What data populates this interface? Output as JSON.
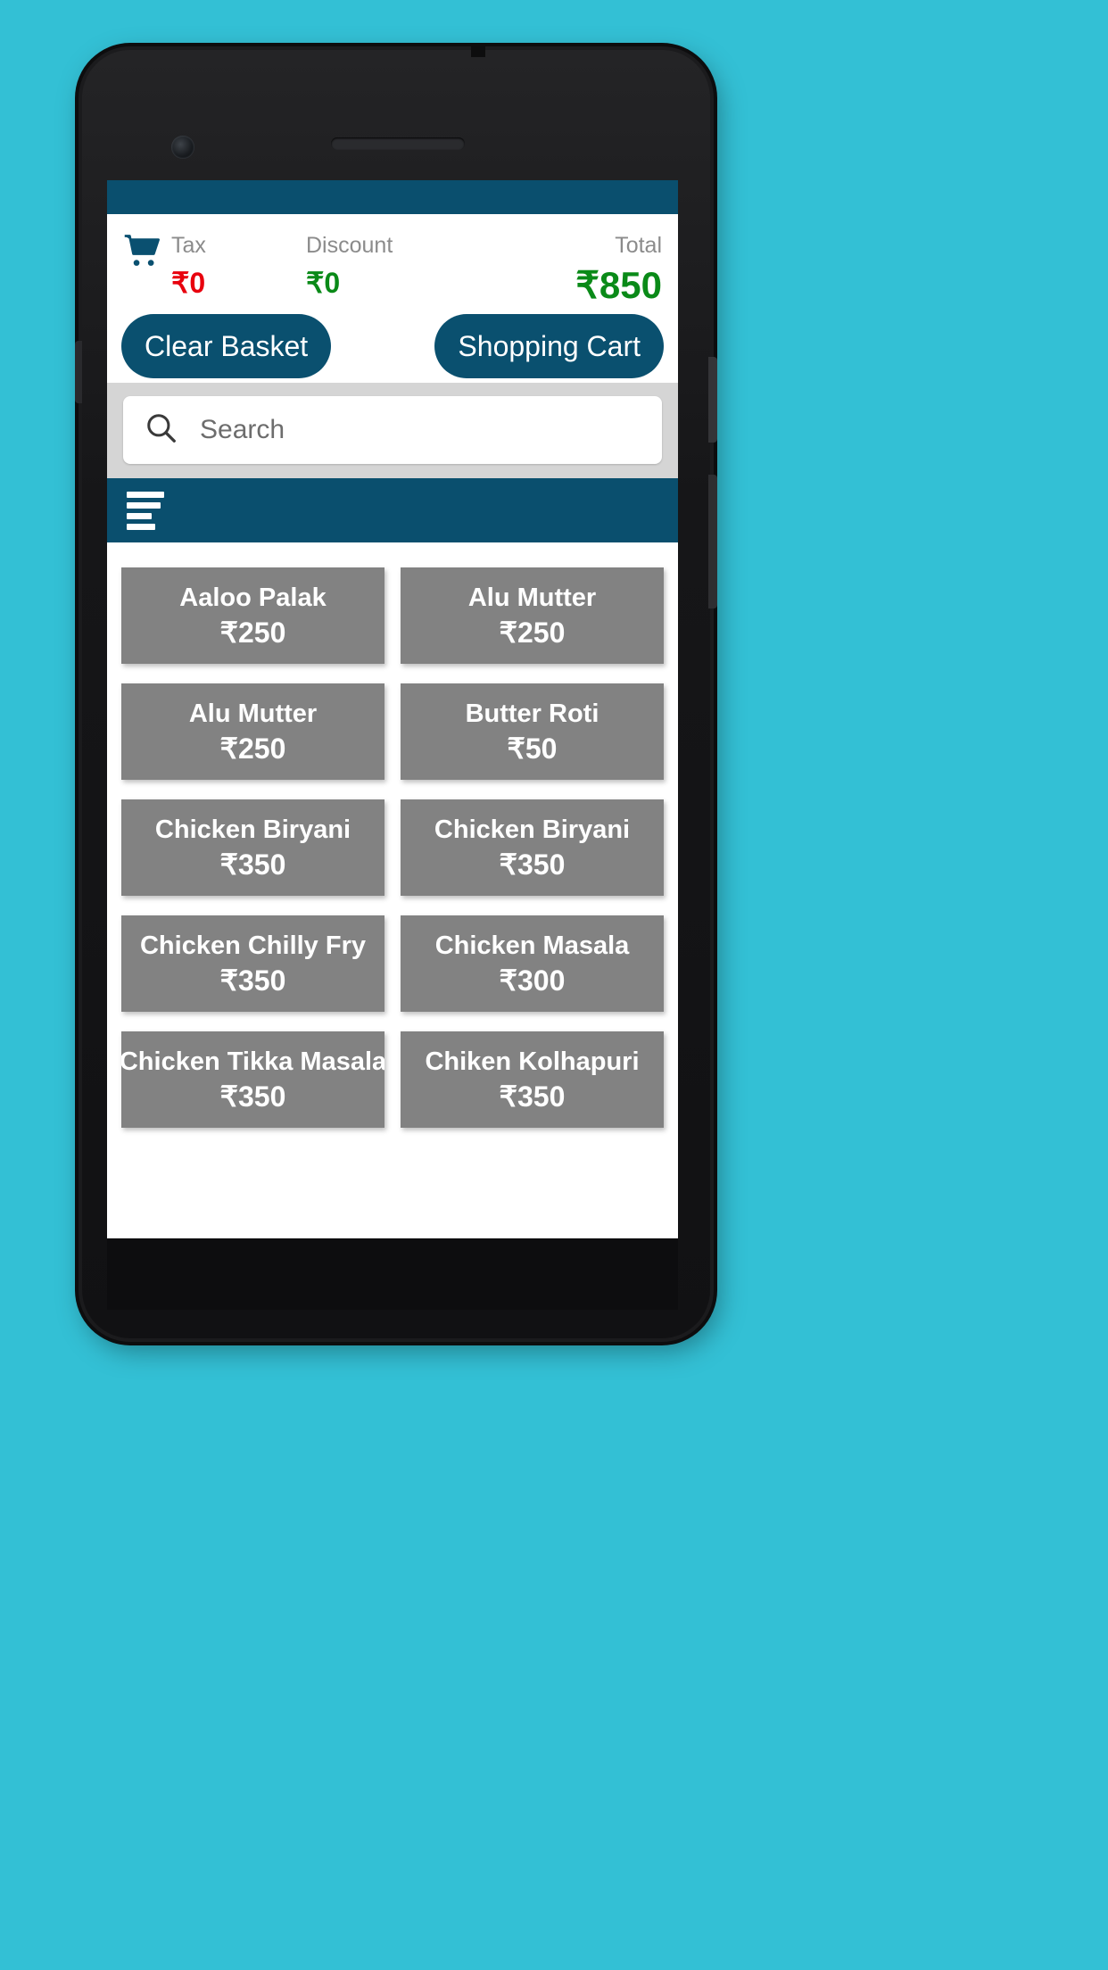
{
  "app": {
    "accent_color": "#0a4f6e",
    "tile_color": "#828282",
    "positive_color": "#0a8a18",
    "negative_color": "#e8000d"
  },
  "summary": {
    "cart_icon": "shopping-cart-icon",
    "tax_label": "Tax",
    "tax_value": "₹0",
    "discount_label": "Discount",
    "discount_value": "₹0",
    "total_label": "Total",
    "total_value": "₹850"
  },
  "actions": {
    "clear_basket_label": "Clear Basket",
    "shopping_cart_label": "Shopping Cart"
  },
  "search": {
    "icon": "search-icon",
    "placeholder": "Search",
    "value": ""
  },
  "menu": {
    "icon": "hamburger-menu-icon"
  },
  "products": [
    {
      "name": "Aaloo Palak",
      "price": "₹250"
    },
    {
      "name": "Alu Mutter",
      "price": "₹250"
    },
    {
      "name": "Alu Mutter",
      "price": "₹250"
    },
    {
      "name": "Butter Roti",
      "price": "₹50"
    },
    {
      "name": "Chicken Biryani",
      "price": "₹350"
    },
    {
      "name": "Chicken Biryani",
      "price": "₹350"
    },
    {
      "name": "Chicken Chilly Fry",
      "price": "₹350"
    },
    {
      "name": "Chicken Masala",
      "price": "₹300"
    },
    {
      "name": "Chicken Tikka Masala",
      "price": "₹350"
    },
    {
      "name": "Chiken Kolhapuri",
      "price": "₹350"
    }
  ]
}
